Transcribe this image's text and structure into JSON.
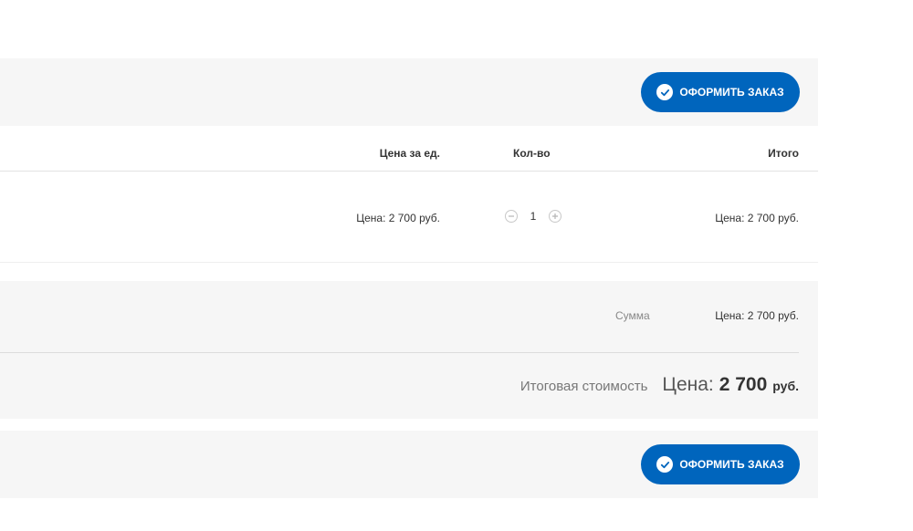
{
  "top_bar": {
    "order_button_label": "ОФОРМИТЬ ЗАКАЗ"
  },
  "table": {
    "headers": {
      "price": "Цена за ед.",
      "qty": "Кол-во",
      "total": "Итого"
    },
    "rows": [
      {
        "price": "Цена: 2 700 руб.",
        "qty": "1",
        "total": "Цена: 2 700 руб."
      }
    ]
  },
  "summary": {
    "sum_label": "Сумма",
    "sum_value": "Цена: 2 700 руб.",
    "total_label": "Итоговая стоимость",
    "total_prefix": "Цена:",
    "total_amount": "2 700",
    "total_currency": "руб."
  },
  "bottom_bar": {
    "order_button_label": "ОФОРМИТЬ ЗАКАЗ"
  },
  "colors": {
    "accent": "#0065bd",
    "panel_bg": "#f6f6f6"
  },
  "icons": {
    "order_button": "check-circle-icon",
    "qty_minus": "minus-circle-icon",
    "qty_plus": "plus-circle-icon"
  }
}
